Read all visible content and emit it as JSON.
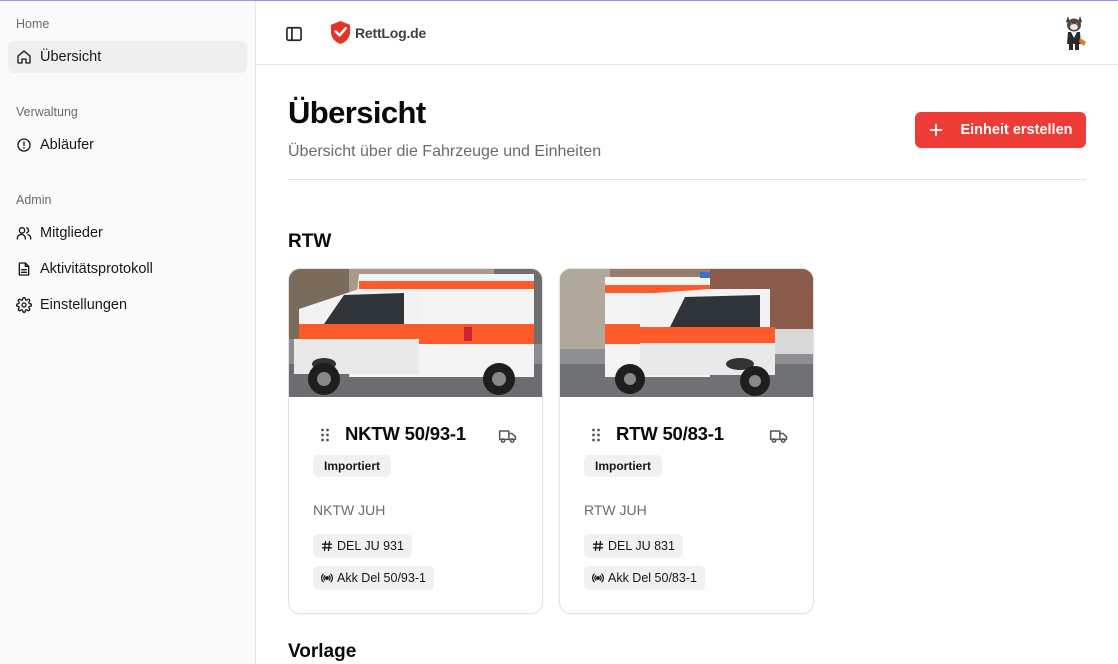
{
  "app": {
    "brand": "RettLog.de"
  },
  "sidebar": {
    "groups": [
      {
        "label": "Home",
        "items": [
          {
            "label": "Übersicht",
            "icon": "home-icon",
            "active": true
          }
        ]
      },
      {
        "label": "Verwaltung",
        "items": [
          {
            "label": "Abläufer",
            "icon": "alert-circle-icon"
          }
        ]
      },
      {
        "label": "Admin",
        "items": [
          {
            "label": "Mitglieder",
            "icon": "users-icon"
          },
          {
            "label": "Aktivitätsprotokoll",
            "icon": "file-text-icon"
          },
          {
            "label": "Einstellungen",
            "icon": "gear-icon"
          }
        ]
      }
    ]
  },
  "main": {
    "title": "Übersicht",
    "subtitle": "Übersicht über die Fahrzeuge und Einheiten",
    "create_button": "Einheit erstellen",
    "sections": [
      {
        "title": "RTW",
        "cards": [
          {
            "name": "NKTW 50/93-1",
            "badge": "Importiert",
            "type": "NKTW JUH",
            "plate": "DEL JU 931",
            "radio": "Akk Del 50/93-1"
          },
          {
            "name": "RTW 50/83-1",
            "badge": "Importiert",
            "type": "RTW JUH",
            "plate": "DEL JU 831",
            "radio": "Akk Del 50/83-1"
          }
        ]
      },
      {
        "title": "Vorlage",
        "cards": []
      }
    ]
  },
  "colors": {
    "accent": "#ef3b36",
    "ambulance_stripe": "#ff5a2a",
    "sidebar_bg": "#fafafa"
  }
}
